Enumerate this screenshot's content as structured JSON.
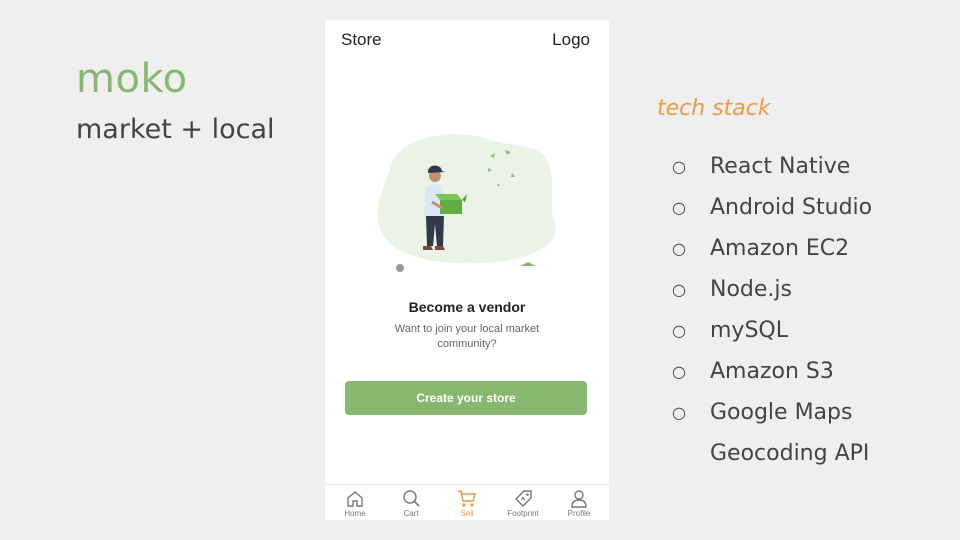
{
  "slide": {
    "title": "moko",
    "subtitle": "market + local"
  },
  "tech_stack": {
    "heading": "tech stack",
    "items": [
      "React Native",
      "Android Studio",
      "Amazon EC2",
      "Node.js",
      "mySQL",
      "Amazon S3",
      "Google Maps",
      "Geocoding API"
    ]
  },
  "phone": {
    "header": {
      "left": "Store",
      "right": "Logo"
    },
    "vendor": {
      "title": "Become a vendor",
      "description": "Want to join your local market community?",
      "button_label": "Create your store"
    },
    "nav": [
      {
        "label": "Home",
        "icon": "home-icon"
      },
      {
        "label": "Cart",
        "icon": "search-icon"
      },
      {
        "label": "Sell",
        "icon": "cart-icon",
        "active": true
      },
      {
        "label": "Footprint",
        "icon": "tag-icon"
      },
      {
        "label": "Profile",
        "icon": "person-icon"
      }
    ]
  },
  "colors": {
    "accent_green": "#86b86f",
    "accent_orange": "#ee9a45",
    "background": "#efefef"
  }
}
